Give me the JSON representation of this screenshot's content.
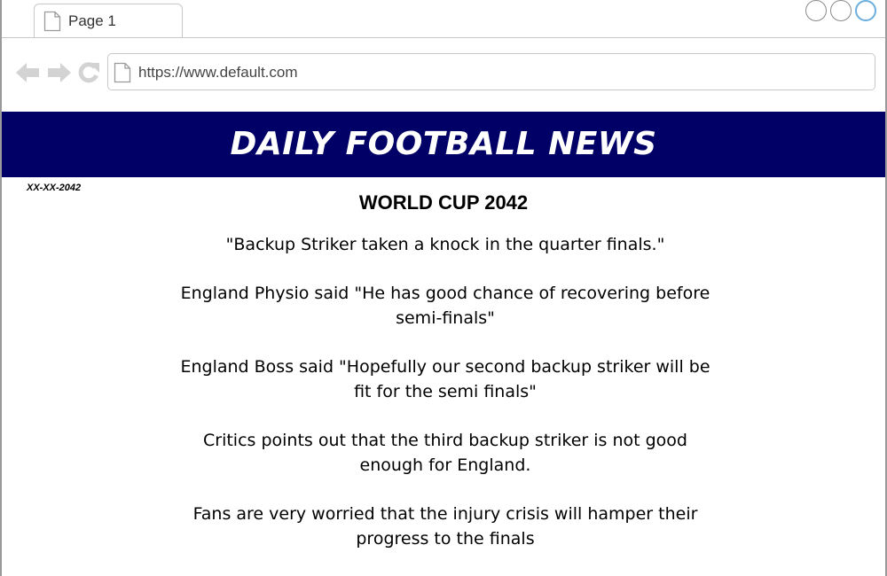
{
  "browser": {
    "tab": {
      "label": "Page 1"
    },
    "url": "https://www.default.com",
    "icons": {
      "back": "arrow-left-icon",
      "forward": "arrow-right-icon",
      "reload": "reload-icon",
      "page": "page-icon"
    }
  },
  "page": {
    "banner_title": "DAILY FOOTBALL NEWS",
    "date": "XX-XX-2042",
    "headline": "WORLD CUP 2042",
    "paragraphs": [
      "\"Backup Striker taken a knock in the quarter finals.\"",
      "England Physio said \"He has good chance of recovering before semi-finals\"",
      "England Boss said \"Hopefully our second backup striker will be fit for the semi finals\"",
      "Critics points out that the third backup striker is not good enough for England.",
      "Fans are very worried that the injury crisis will hamper their progress to the finals"
    ],
    "colors": {
      "banner_background": "#010066",
      "banner_text": "#ffffff"
    }
  }
}
